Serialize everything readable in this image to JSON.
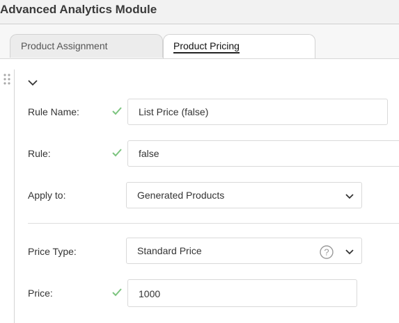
{
  "header": {
    "title": "Advanced Analytics Module"
  },
  "tabs": [
    {
      "label": "Product Assignment",
      "active": false
    },
    {
      "label": "Product Pricing",
      "active": true
    }
  ],
  "form": {
    "rule_name": {
      "label": "Rule Name:",
      "value": "List Price (false)",
      "valid": true
    },
    "rule": {
      "label": "Rule:",
      "value": "false",
      "valid": true
    },
    "apply_to": {
      "label": "Apply to:",
      "value": "Generated Products"
    },
    "price_type": {
      "label": "Price Type:",
      "value": "Standard Price"
    },
    "price": {
      "label": "Price:",
      "value": "1000",
      "valid": true
    }
  },
  "colors": {
    "check": "#7cc47f",
    "border": "#d9d9d9",
    "text": "#333333"
  }
}
